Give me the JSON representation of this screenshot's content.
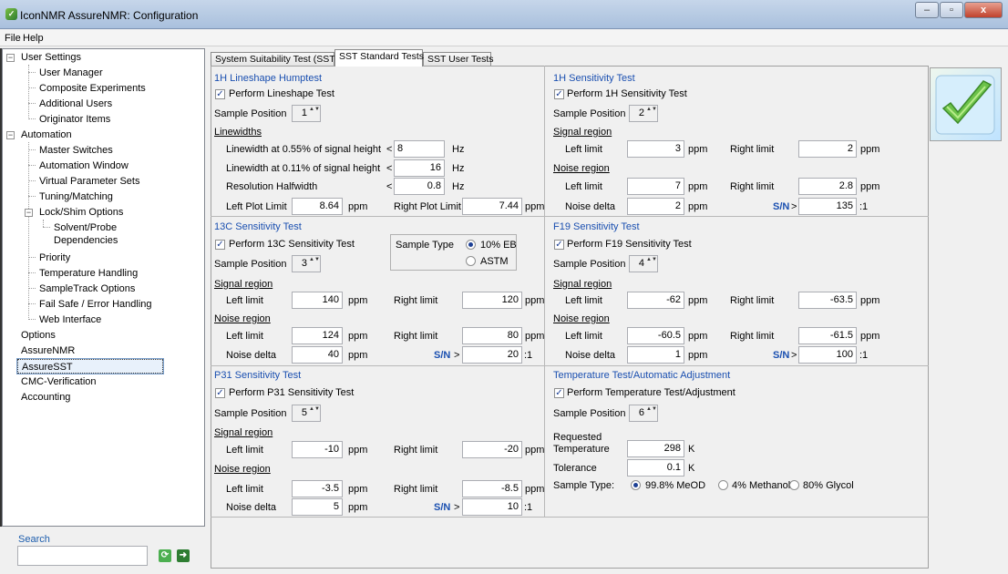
{
  "window": {
    "title": "IconNMR AssureNMR: Configuration",
    "minimize": "‒",
    "maximize": "▫",
    "close": "x"
  },
  "menu": {
    "file": "File",
    "help": "Help"
  },
  "tree": {
    "user_settings": "User Settings",
    "user_manager": "User Manager",
    "composite": "Composite Experiments",
    "additional_users": "Additional Users",
    "originator": "Originator Items",
    "automation": "Automation",
    "master": "Master Switches",
    "automation_window": "Automation Window",
    "virtual": "Virtual Parameter Sets",
    "tuning": "Tuning/Matching",
    "lockshim": "Lock/Shim Options",
    "solvent1": "Solvent/Probe",
    "solvent2": "Dependencies",
    "priority": "Priority",
    "temperature": "Temperature Handling",
    "sampletrack": "SampleTrack Options",
    "failsafe": "Fail Safe / Error Handling",
    "web": "Web Interface",
    "options": "Options",
    "assurenmr": "AssureNMR",
    "assuresst": "AssureSST",
    "cmc": "CMC-Verification",
    "accounting": "Accounting"
  },
  "search": {
    "label": "Search",
    "value": ""
  },
  "tabs": [
    "System Suitability Test (SST)",
    "SST Standard Tests",
    "SST User Tests"
  ],
  "h1_lineshape": {
    "title": "1H Lineshape Humptest",
    "check": "Perform Lineshape Test",
    "sample_position_label": "Sample Position",
    "sample_position": "1",
    "linewidths": "Linewidths",
    "lw055": "Linewidth at 0.55% of signal height",
    "lw055_op": "<",
    "lw055_val": "8",
    "lw011": "Linewidth at 0.11% of signal height",
    "lw011_op": "<",
    "lw011_val": "16",
    "res": "Resolution Halfwidth",
    "res_op": "<",
    "res_val": "0.8",
    "hz": "Hz",
    "left_plot": "Left Plot Limit",
    "left_plot_val": "8.64",
    "right_plot": "Right Plot Limit",
    "right_plot_val": "7.44",
    "ppm": "ppm"
  },
  "h1_sens": {
    "title": "1H Sensitivity Test",
    "check": "Perform 1H Sensitivity Test",
    "sample_position_label": "Sample Position",
    "sample_position": "2",
    "signal": "Signal region",
    "left": "Left limit",
    "right": "Right limit",
    "sig_left": "3",
    "sig_right": "2",
    "noise": "Noise region",
    "noise_left": "7",
    "noise_right": "2.8",
    "delta": "Noise delta",
    "delta_val": "2",
    "sn": "S/N",
    "gt": ">",
    "sn_val": "135",
    "ratio": ":1",
    "ppm": "ppm"
  },
  "c13": {
    "title": "13C Sensitivity Test",
    "check": "Perform 13C Sensitivity Test",
    "sample_type": "Sample Type",
    "opt1": "10% EB",
    "opt2": "ASTM",
    "sample_position_label": "Sample Position",
    "sample_position": "3",
    "signal": "Signal region",
    "left": "Left limit",
    "right": "Right limit",
    "sig_left": "140",
    "sig_right": "120",
    "noise": "Noise region",
    "noise_left": "124",
    "noise_right": "80",
    "delta": "Noise delta",
    "delta_val": "40",
    "sn": "S/N",
    "gt": ">",
    "sn_val": "20",
    "ratio": ":1",
    "ppm": "ppm"
  },
  "f19": {
    "title": "F19 Sensitivity Test",
    "check": "Perform F19 Sensitivity Test",
    "sample_position_label": "Sample Position",
    "sample_position": "4",
    "signal": "Signal region",
    "left": "Left limit",
    "right": "Right limit",
    "sig_left": "-62",
    "sig_right": "-63.5",
    "noise": "Noise region",
    "noise_left": "-60.5",
    "noise_right": "-61.5",
    "delta": "Noise delta",
    "delta_val": "1",
    "sn": "S/N",
    "gt": ">",
    "sn_val": "100",
    "ratio": ":1",
    "ppm": "ppm"
  },
  "p31": {
    "title": "P31 Sensitivity Test",
    "check": "Perform P31 Sensitivity Test",
    "sample_position_label": "Sample Position",
    "sample_position": "5",
    "signal": "Signal region",
    "left": "Left limit",
    "right": "Right limit",
    "sig_left": "-10",
    "sig_right": "-20",
    "noise": "Noise region",
    "noise_left": "-3.5",
    "noise_right": "-8.5",
    "delta": "Noise delta",
    "delta_val": "5",
    "sn": "S/N",
    "gt": ">",
    "sn_val": "10",
    "ratio": ":1",
    "ppm": "ppm"
  },
  "temp": {
    "title": "Temperature Test/Automatic Adjustment",
    "check": "Perform Temperature Test/Adjustment",
    "sample_position_label": "Sample Position",
    "sample_position": "6",
    "req1": "Requested",
    "req2": "Temperature",
    "req_val": "298",
    "k": "K",
    "tol": "Tolerance",
    "tol_val": "0.1",
    "sample_type": "Sample Type:",
    "opt1": "99.8% MeOD",
    "opt2": "4% Methanol",
    "opt3": "80% Glycol"
  },
  "symbols": {
    "check": "✓",
    "spin": "▲▼",
    "plus": "+",
    "minus": "−"
  }
}
